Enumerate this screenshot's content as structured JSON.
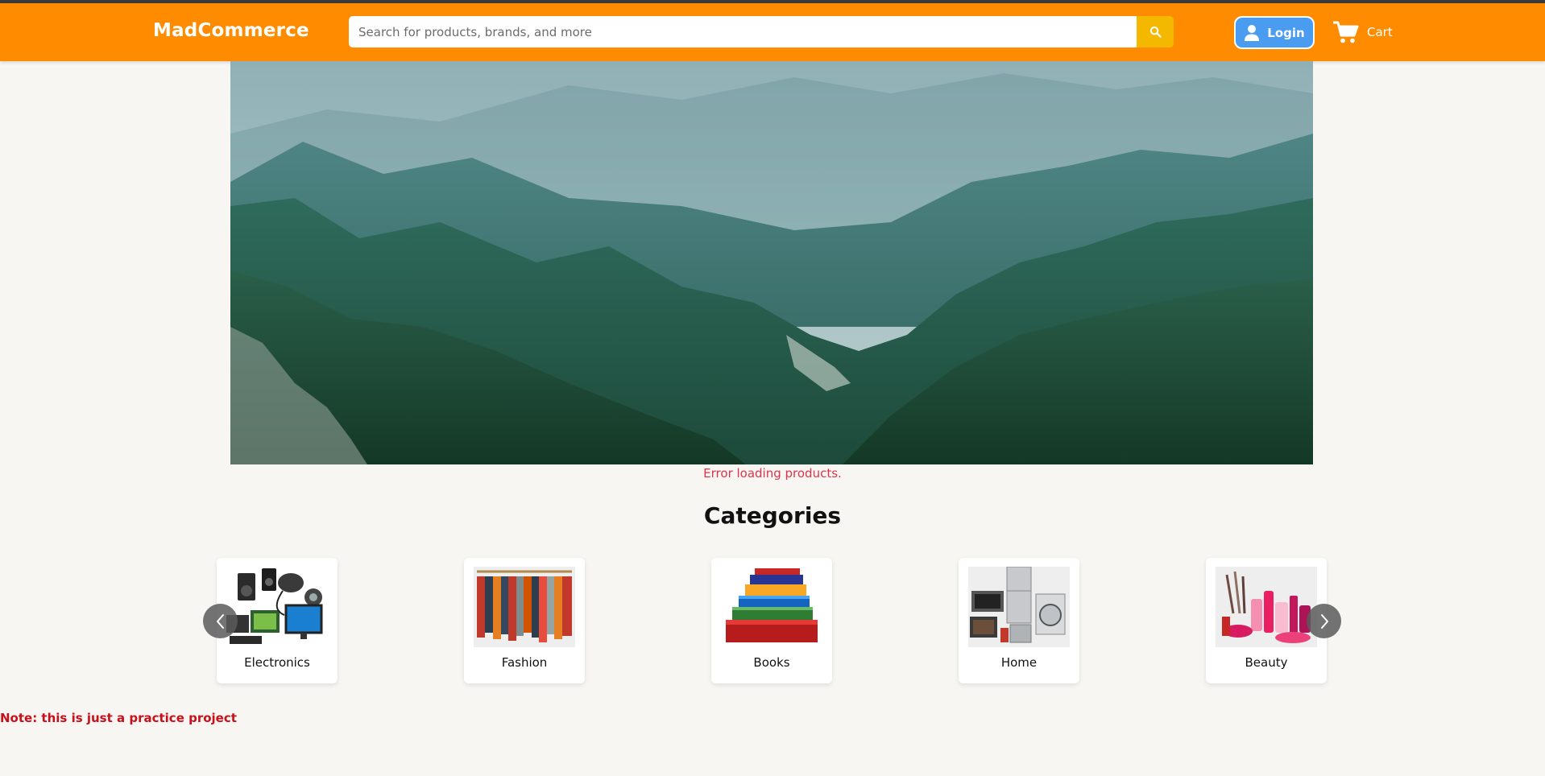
{
  "header": {
    "brand": "MadCommerce",
    "search_placeholder": "Search for products, brands, and more",
    "login_label": "Login",
    "cart_label": "Cart"
  },
  "colors": {
    "navbar": "#ff8c00",
    "search_button": "#f5b800",
    "login_button": "#4a9cf0",
    "error": "#e0334a",
    "note": "#c8101a"
  },
  "banner": {
    "image": "mountain-valley-landscape"
  },
  "status": {
    "error": "Error loading products."
  },
  "categories": {
    "title": "Categories",
    "items": [
      {
        "label": "Electronics",
        "icon": "electronics-image"
      },
      {
        "label": "Fashion",
        "icon": "fashion-image"
      },
      {
        "label": "Books",
        "icon": "books-image"
      },
      {
        "label": "Home",
        "icon": "home-appliances-image"
      },
      {
        "label": "Beauty",
        "icon": "beauty-image"
      }
    ]
  },
  "footer": {
    "note": "Note: this is just a practice project"
  }
}
